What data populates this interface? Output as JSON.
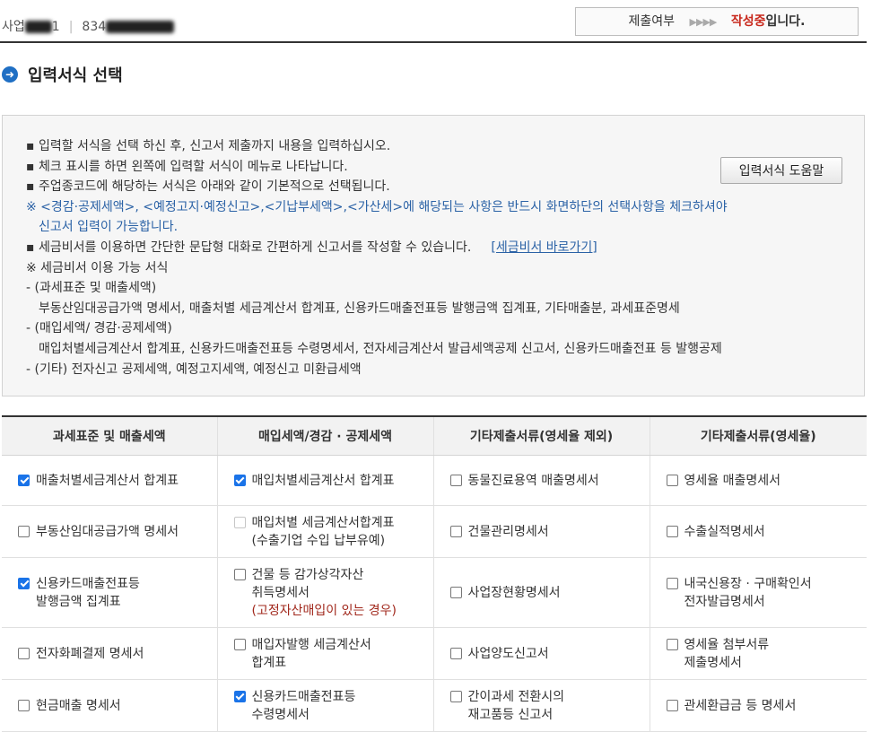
{
  "header": {
    "biz_label": "사업",
    "biz_label_suffix": "1",
    "biz_number_prefix": "834",
    "status_label": "제출여부",
    "status_arrows": "▶▶▶▶",
    "status_value": "작성중",
    "status_suffix": "입니다."
  },
  "section": {
    "title": "입력서식 선택"
  },
  "info": {
    "lines": [
      "▪ 입력할 서식을 선택 하신 후, 신고서 제출까지 내용을 입력하십시오.",
      "▪ 체크 표시를 하면 왼쪽에 입력할 서식이 메뉴로 나타납니다.",
      "▪ 주업종코드에 해당하는 서식은 아래와 같이 기본적으로 선택됩니다."
    ],
    "warning_1": "※ <경감·공제세액>, <예정고지·예정신고>,<기납부세액>,<가산세>에 해당되는 사항은 반드시  화면하단의 선택사항을 체크하셔야",
    "warning_2": "신고서 입력이 가능합니다.",
    "secretary_line": "▪ 세금비서를 이용하면 간단한 문답형 대화로 간편하게 신고서를 작성할 수 있습니다.",
    "secretary_link": "[세금비서 바로가기]",
    "avail_title": "※ 세금비서 이용 가능 서식",
    "group1_title": "- (과세표준 및 매출세액)",
    "group1_items": "부동산임대공급가액 명세서, 매출처별 세금계산서 합계표, 신용카드매출전표등 발행금액 집계표, 기타매출분, 과세표준명세",
    "group2_title": "- (매입세액/ 경감·공제세액)",
    "group2_items": "매입처별세금계산서 합계표, 신용카드매출전표등 수령명세서, 전자세금계산서 발급세액공제 신고서, 신용카드매출전표 등 발행공제",
    "group3": "- (기타) 전자신고 공제세액, 예정고지세액, 예정신고 미환급세액",
    "help_button": "입력서식 도움말"
  },
  "table": {
    "headers": [
      "과세표준 및 매출세액",
      "매입세액/경감 · 공제세액",
      "기타제출서류(영세율 제외)",
      "기타제출서류(영세율)"
    ],
    "rows": [
      [
        {
          "l1": "매출처별세금계산서 합계표",
          "checked": true
        },
        {
          "l1": "매입처별세금계산서 합계표",
          "checked": true
        },
        {
          "l1": "동물진료용역 매출명세서",
          "checked": false
        },
        {
          "l1": "영세율 매출명세서",
          "checked": false
        }
      ],
      [
        {
          "l1": "부동산임대공급가액 명세서",
          "checked": false
        },
        {
          "l1": "매입처별 세금계산서합계표",
          "l2": "(수출기업 수입 납부유예)",
          "checked": false,
          "disabled": true
        },
        {
          "l1": "건물관리명세서",
          "checked": false
        },
        {
          "l1": "수출실적명세서",
          "checked": false
        }
      ],
      [
        {
          "l1": "신용카드매출전표등",
          "l2": "발행금액 집계표",
          "checked": true
        },
        {
          "l1": "건물 등 감가상각자산",
          "l2": "취득명세서",
          "l3": "(고정자산매입이 있는 경우)",
          "checked": false
        },
        {
          "l1": "사업장현황명세서",
          "checked": false
        },
        {
          "l1": "내국신용장 · 구매확인서",
          "l2": "전자발급명세서",
          "checked": false
        }
      ],
      [
        {
          "l1": "전자화폐결제 명세서",
          "checked": false
        },
        {
          "l1": "매입자발행 세금계산서",
          "l2": "합계표",
          "checked": false
        },
        {
          "l1": "사업양도신고서",
          "checked": false
        },
        {
          "l1": "영세율 첨부서류",
          "l2": "제출명세서",
          "checked": false
        }
      ],
      [
        {
          "l1": "현금매출 명세서",
          "checked": false
        },
        {
          "l1": "신용카드매출전표등",
          "l2": "수령명세서",
          "checked": true
        },
        {
          "l1": "간이과세 전환시의",
          "l2": "재고품등 신고서",
          "checked": false
        },
        {
          "l1": "관세환급금 등 명세서",
          "checked": false
        }
      ]
    ]
  },
  "colors": {
    "accent": "#1f6fc4",
    "status": "#c8281c",
    "link": "#2b62a6",
    "check": "#1a73e8"
  }
}
